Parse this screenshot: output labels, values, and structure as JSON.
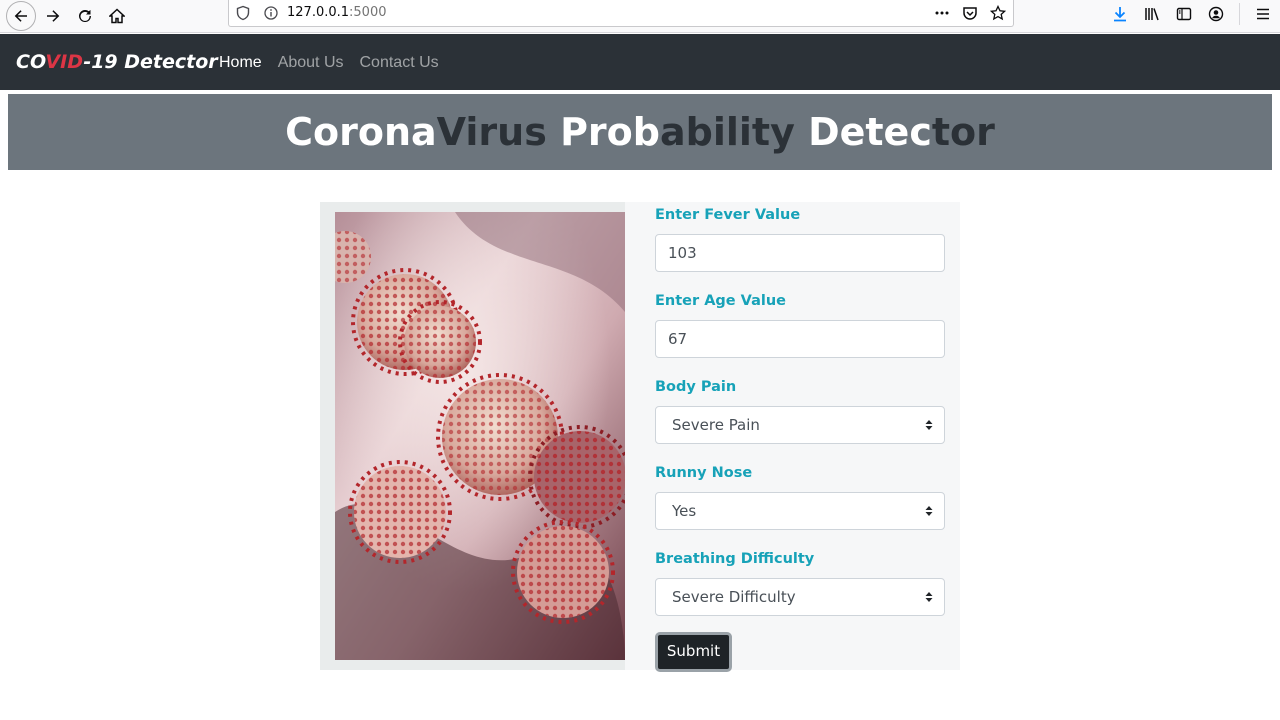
{
  "browser": {
    "url_host": "127.0.0.1",
    "url_port": ":5000"
  },
  "navbar": {
    "brand_co": "CO",
    "brand_vid": "VID",
    "brand_rest": "-19 Detector",
    "links": [
      {
        "label": "Home",
        "active": true
      },
      {
        "label": "About Us",
        "active": false
      },
      {
        "label": "Contact Us",
        "active": false
      }
    ]
  },
  "banner": {
    "part1": "Corona",
    "part2": "Virus",
    "part3": " Prob",
    "part4": "ability",
    "part5": " Detec",
    "part6": "tor"
  },
  "form": {
    "fever_label": "Enter Fever Value",
    "fever_value": "103",
    "age_label": "Enter Age Value",
    "age_value": "67",
    "body_pain_label": "Body Pain",
    "body_pain_value": "Severe Pain",
    "runny_nose_label": "Runny Nose",
    "runny_nose_value": "Yes",
    "breathing_label": "Breathing Difficulty",
    "breathing_value": "Severe Difficulty",
    "submit_label": "Submit"
  },
  "colors": {
    "navbar_bg": "#2b3137",
    "banner_bg": "#6c757d",
    "label_color": "#17a2b8",
    "brand_accent": "#dc3545"
  }
}
